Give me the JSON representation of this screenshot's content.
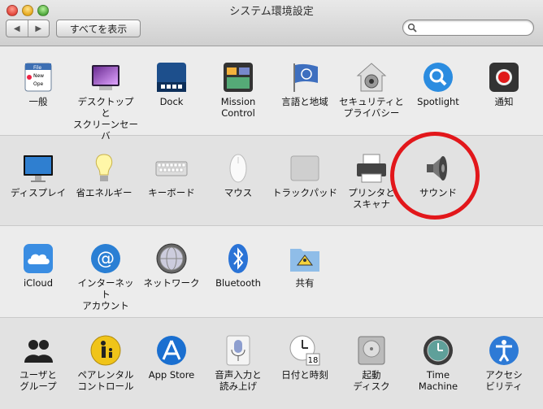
{
  "window": {
    "title": "システム環境設定",
    "show_all_label": "すべてを表示",
    "search_value": "",
    "search_placeholder": ""
  },
  "rows": [
    {
      "items": [
        {
          "id": "general",
          "label": "一般",
          "icon": "general-icon"
        },
        {
          "id": "desktop",
          "label": "デスクトップと\nスクリーンセーバ",
          "icon": "desktop-icon"
        },
        {
          "id": "dock",
          "label": "Dock",
          "icon": "dock-icon"
        },
        {
          "id": "mission",
          "label": "Mission\nControl",
          "icon": "mission-control-icon"
        },
        {
          "id": "language",
          "label": "言語と地域",
          "icon": "flag-icon"
        },
        {
          "id": "security",
          "label": "セキュリティと\nプライバシー",
          "icon": "house-lock-icon"
        },
        {
          "id": "spotlight",
          "label": "Spotlight",
          "icon": "spotlight-icon"
        },
        {
          "id": "notifications",
          "label": "通知",
          "icon": "notification-icon"
        }
      ]
    },
    {
      "items": [
        {
          "id": "displays",
          "label": "ディスプレイ",
          "icon": "display-icon"
        },
        {
          "id": "energy",
          "label": "省エネルギー",
          "icon": "bulb-icon"
        },
        {
          "id": "keyboard",
          "label": "キーボード",
          "icon": "keyboard-icon"
        },
        {
          "id": "mouse",
          "label": "マウス",
          "icon": "mouse-icon"
        },
        {
          "id": "trackpad",
          "label": "トラックパッド",
          "icon": "trackpad-icon"
        },
        {
          "id": "printers",
          "label": "プリンタと\nスキャナ",
          "icon": "printer-icon"
        },
        {
          "id": "sound",
          "label": "サウンド",
          "icon": "speaker-icon"
        }
      ]
    },
    {
      "items": [
        {
          "id": "icloud",
          "label": "iCloud",
          "icon": "cloud-icon"
        },
        {
          "id": "internet",
          "label": "インターネット\nアカウント",
          "icon": "at-icon"
        },
        {
          "id": "network",
          "label": "ネットワーク",
          "icon": "globe-icon"
        },
        {
          "id": "bluetooth",
          "label": "Bluetooth",
          "icon": "bluetooth-icon"
        },
        {
          "id": "sharing",
          "label": "共有",
          "icon": "folder-sharing-icon"
        }
      ]
    },
    {
      "items": [
        {
          "id": "users",
          "label": "ユーザと\nグループ",
          "icon": "users-icon"
        },
        {
          "id": "parental",
          "label": "ペアレンタル\nコントロール",
          "icon": "parental-icon"
        },
        {
          "id": "appstore",
          "label": "App Store",
          "icon": "app-store-icon"
        },
        {
          "id": "dictation",
          "label": "音声入力と\n読み上げ",
          "icon": "microphone-icon"
        },
        {
          "id": "datetime",
          "label": "日付と時刻",
          "icon": "clock-icon"
        },
        {
          "id": "startup",
          "label": "起動\nディスク",
          "icon": "disk-icon"
        },
        {
          "id": "timemachine",
          "label": "Time\nMachine",
          "icon": "time-machine-icon"
        },
        {
          "id": "accessibility",
          "label": "アクセシ\nビリティ",
          "icon": "accessibility-icon"
        }
      ]
    }
  ],
  "calendar_badge": "18",
  "general_icon_text": [
    "File",
    "New",
    "Ope"
  ]
}
